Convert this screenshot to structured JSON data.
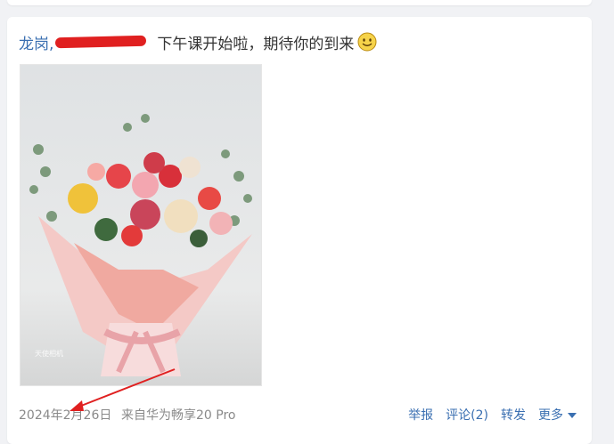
{
  "post": {
    "author": "龙岗,",
    "text": "下午课开始啦，期待你的到来",
    "emoji_icon": "smiley-face-icon",
    "image_alt": "Bouquet of roses wrapped in pink paper",
    "watermark": "天使相机"
  },
  "footer": {
    "date": "2024年2月26日",
    "source": "来自华为畅享20 Pro",
    "report": "举报",
    "comment": "评论(2)",
    "repost": "转发",
    "more": "更多"
  },
  "colors": {
    "link": "#3a6fb1",
    "meta": "#8a8a8a",
    "annotation_red": "#e02020",
    "background": "#f1f2f5"
  }
}
